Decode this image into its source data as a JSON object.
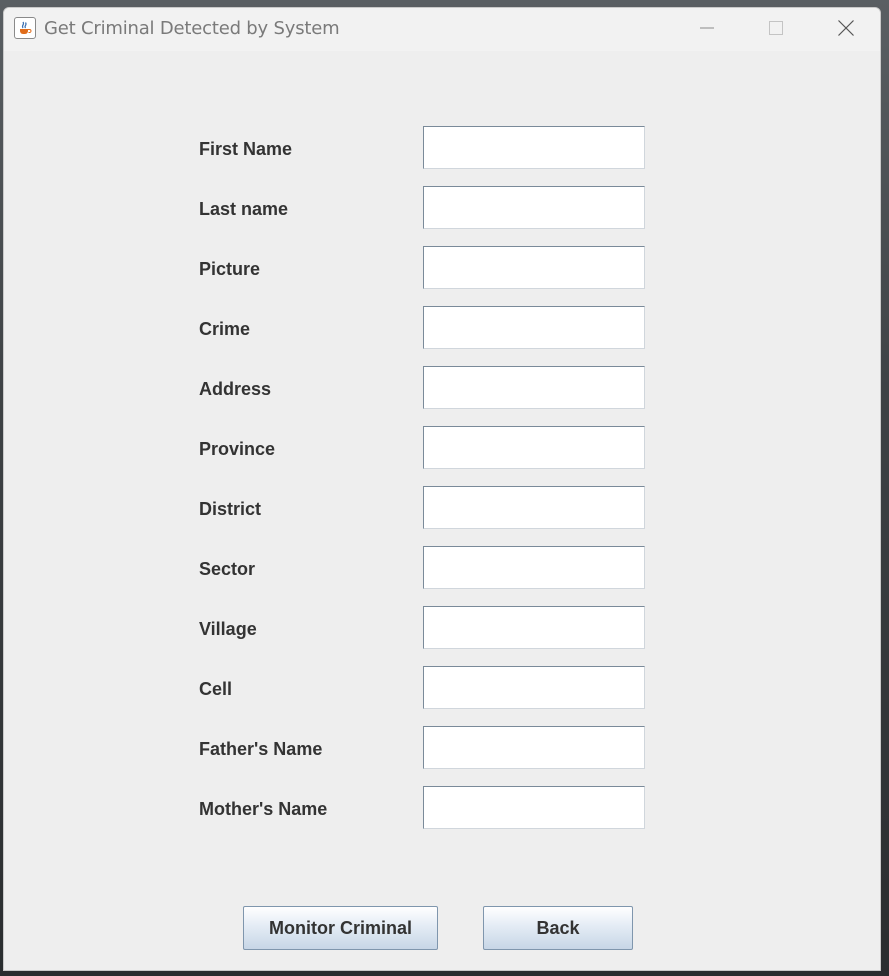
{
  "window": {
    "title": "Get Criminal Detected by System",
    "icons": {
      "app": "java-coffee-icon",
      "minimize": "minimize-icon",
      "maximize": "maximize-icon",
      "close": "close-icon"
    }
  },
  "form": {
    "fields": [
      {
        "label": "First Name",
        "value": ""
      },
      {
        "label": "Last name",
        "value": ""
      },
      {
        "label": "Picture",
        "value": ""
      },
      {
        "label": "Crime",
        "value": ""
      },
      {
        "label": "Address",
        "value": ""
      },
      {
        "label": "Province",
        "value": ""
      },
      {
        "label": "District",
        "value": ""
      },
      {
        "label": "Sector",
        "value": ""
      },
      {
        "label": "Village",
        "value": ""
      },
      {
        "label": "Cell",
        "value": ""
      },
      {
        "label": "Father's Name",
        "value": ""
      },
      {
        "label": "Mother's Name",
        "value": ""
      }
    ]
  },
  "buttons": {
    "monitor_label": "Monitor Criminal",
    "back_label": "Back"
  },
  "colors": {
    "window_bg": "#eeeeee",
    "label_text": "#333333",
    "field_border": "#7a8a99",
    "button_gradient_bottom": "#c7d6e6"
  }
}
